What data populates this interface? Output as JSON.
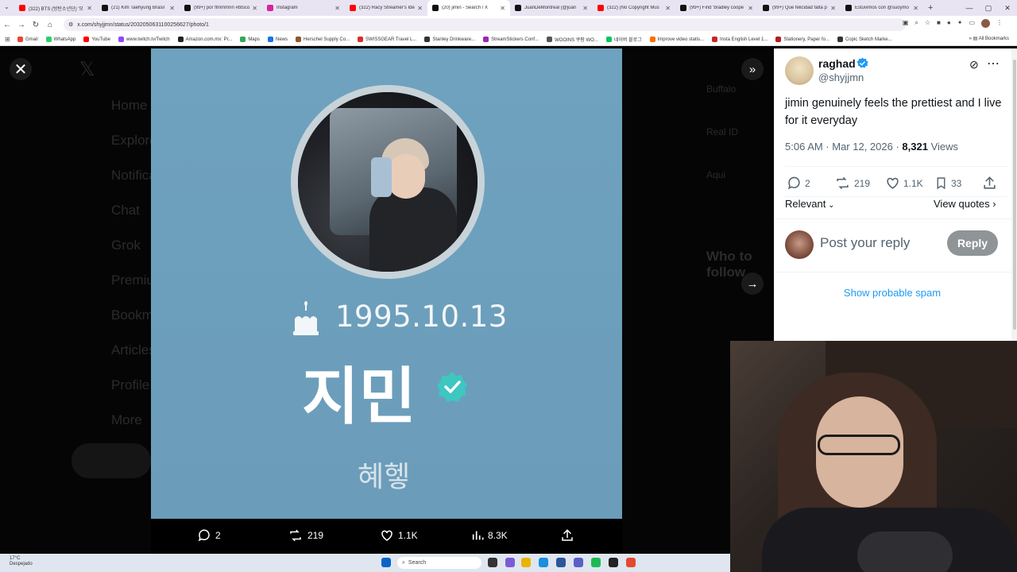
{
  "browser": {
    "tabs": [
      {
        "title": "(322) BTS (방탄소년단) '모",
        "color": "#ff0000",
        "active": false
      },
      {
        "title": "(21) Kim Taehyung Brasil",
        "color": "#111111",
        "active": false
      },
      {
        "title": "(99+) por flmmmnn #btsco",
        "color": "#111111",
        "active": false
      },
      {
        "title": "Instagram",
        "color": "#d6249f",
        "active": false
      },
      {
        "title": "(322) Racy Streamer's Ide",
        "color": "#ff0000",
        "active": false
      },
      {
        "title": "(20) jimin - Search / X",
        "color": "#111111",
        "active": true
      },
      {
        "title": "JuanDeMontreal (@juan",
        "color": "#111111",
        "active": false
      },
      {
        "title": "(322) (No Copyright Mus",
        "color": "#ff0000",
        "active": false
      },
      {
        "title": "(99+) Find 'bradley coope",
        "color": "#111111",
        "active": false
      },
      {
        "title": "(99+) Que felicidad falta p",
        "color": "#111111",
        "active": false
      },
      {
        "title": "Estuvimos con @suoymo",
        "color": "#111111",
        "active": false
      }
    ],
    "url": "x.com/shyjjmn/status/2032050631100256627/photo/1",
    "bookmarks": [
      "Gmail",
      "WhatsApp",
      "YouTube",
      "www.twitch.tv/Twitch",
      "Amazon.com.mx: Pr...",
      "Maps",
      "News",
      "Herschel Supply Co...",
      "SWISSGEAR Travel L...",
      "Stanley Drinkware...",
      "StreamStickers Conf...",
      "WOOINS 쿠팡 WO...",
      "네이버 블로그",
      "Improve video statis...",
      "Insta English Level 1...",
      "Stationery, Paper fo...",
      "Copic Sketch Marke..."
    ],
    "all_bookmarks": "All Bookmarks"
  },
  "background": {
    "nav": [
      "Home",
      "Explore",
      "Notifications",
      "Chat",
      "Grok",
      "Premium",
      "Bookmarks",
      "Articles",
      "Profile",
      "More"
    ],
    "side": [
      "Buffalo",
      "Real ID",
      "Aqui",
      "Who to follow"
    ]
  },
  "photo": {
    "birthday": "1995.10.13",
    "name": "지민",
    "handle": "혜헿"
  },
  "media_bar": {
    "replies": "2",
    "reposts": "219",
    "likes": "1.1K",
    "views": "8.3K"
  },
  "tweet": {
    "name": "raghad",
    "handle": "@shyjjmn",
    "text": "jimin genuinely feels the prettiest and I live for it everyday",
    "time": "5:06 AM · Mar 12, 2026 · ",
    "views_count": "8,321",
    "views_label": " Views",
    "replies": "2",
    "reposts": "219",
    "likes": "1.1K",
    "bookmarks": "33",
    "relevant": "Relevant",
    "view_quotes": "View quotes",
    "reply_placeholder": "Post your reply",
    "reply_button": "Reply",
    "show_spam": "Show probable spam"
  },
  "taskbar": {
    "temp": "17°C",
    "weather": "Despejado",
    "search": "Search"
  },
  "colors": {
    "accent": "#1d9bf0",
    "photo_bg": "#6fa2be",
    "verified": "#1d9bf0"
  }
}
